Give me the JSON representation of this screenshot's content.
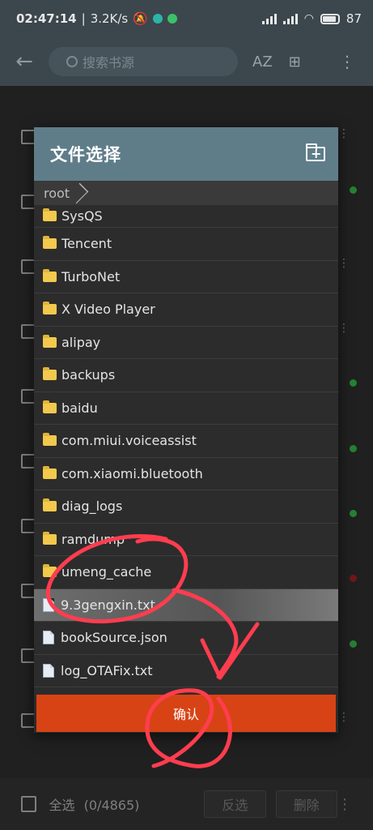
{
  "status_bar": {
    "time": "02:47:14",
    "separator": "|",
    "network_speed": "3.2K/s",
    "battery_level": "87",
    "battery_fraction": 0.87,
    "app_dot_colors": [
      "#2bb5a8",
      "#3cc06a"
    ]
  },
  "toolbar": {
    "back_icon": "arrow-left-icon",
    "search_placeholder": "搜索书源",
    "sort_label": "AZ",
    "group_icon": "grid-icon",
    "more_icon": "more-vert-icon"
  },
  "dialog": {
    "title": "文件选择",
    "new_folder_icon": "create-new-folder-icon",
    "breadcrumb": "root",
    "files": [
      {
        "name": "SysQS",
        "type": "folder"
      },
      {
        "name": "Tencent",
        "type": "folder"
      },
      {
        "name": "TurboNet",
        "type": "folder"
      },
      {
        "name": "X Video Player",
        "type": "folder"
      },
      {
        "name": "alipay",
        "type": "folder"
      },
      {
        "name": "backups",
        "type": "folder"
      },
      {
        "name": "baidu",
        "type": "folder"
      },
      {
        "name": "com.miui.voiceassist",
        "type": "folder"
      },
      {
        "name": "com.xiaomi.bluetooth",
        "type": "folder"
      },
      {
        "name": "diag_logs",
        "type": "folder"
      },
      {
        "name": "ramdump",
        "type": "folder"
      },
      {
        "name": "umeng_cache",
        "type": "folder"
      },
      {
        "name": "9.3gengxin.txt",
        "type": "file",
        "selected": true
      },
      {
        "name": "bookSource.json",
        "type": "file"
      },
      {
        "name": "log_OTAFix.txt",
        "type": "file"
      }
    ],
    "confirm_label": "确认"
  },
  "bottom_bar": {
    "select_all_label": "全选",
    "count_label": "(0/4865)",
    "invert_label": "反选",
    "delete_label": "删除"
  },
  "colors": {
    "header": "#3b474d",
    "dialog_header": "#5f7d89",
    "confirm": "#d84315",
    "scribble": "#ff3d4f",
    "enabled_dot": "#2e9e3e",
    "disabled_dot": "#8b1d1d"
  }
}
